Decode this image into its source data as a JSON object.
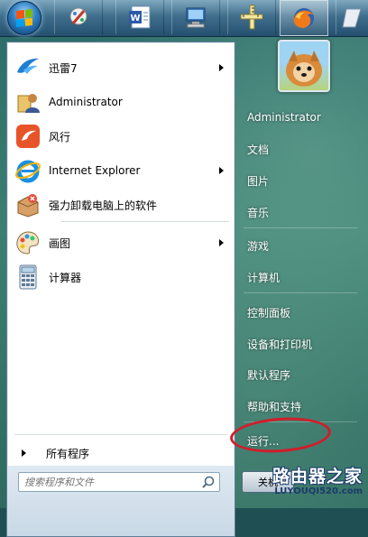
{
  "taskbar": {
    "buttons": [
      {
        "icon": "windows-start-orb-icon"
      },
      {
        "icon": "paint-tool-icon"
      },
      {
        "icon": "word-document-icon"
      },
      {
        "icon": "computer-icon"
      },
      {
        "icon": "ruler-tool-icon"
      },
      {
        "icon": "firefox-icon"
      },
      {
        "icon": "app-icon"
      }
    ]
  },
  "left_pane": {
    "programs": [
      {
        "label": "迅雷7",
        "icon": "xunlei-bird-icon",
        "has_submenu": true
      },
      {
        "label": "Administrator",
        "icon": "user-folder-icon",
        "has_submenu": false
      },
      {
        "label": "风行",
        "icon": "funshion-icon",
        "has_submenu": false
      },
      {
        "label": "Internet Explorer",
        "icon": "internet-explorer-icon",
        "has_submenu": true
      },
      {
        "label": "强力卸载电脑上的软件",
        "icon": "uninstall-box-icon",
        "has_submenu": false
      },
      {
        "label": "画图",
        "icon": "paint-palette-icon",
        "has_submenu": true
      },
      {
        "label": "计算器",
        "icon": "calculator-icon",
        "has_submenu": false
      }
    ],
    "all_programs_label": "所有程序",
    "search_placeholder": "搜索程序和文件"
  },
  "right_pane": {
    "items": [
      {
        "label": "Administrator"
      },
      {
        "label": "文档"
      },
      {
        "label": "图片"
      },
      {
        "label": "音乐"
      },
      {
        "label": "游戏"
      },
      {
        "label": "计算机"
      },
      {
        "label": "控制面板"
      },
      {
        "label": "设备和打印机"
      },
      {
        "label": "默认程序"
      },
      {
        "label": "帮助和支持"
      },
      {
        "label": "运行..."
      }
    ],
    "shutdown_label": "关机"
  },
  "watermark": {
    "line1": "路由器之家",
    "line2": "LUYOUQI520.com"
  },
  "colors": {
    "annotation_circle": "#d11d2a",
    "menu_background": "#ffffff",
    "right_pane_text": "#ffffff"
  }
}
